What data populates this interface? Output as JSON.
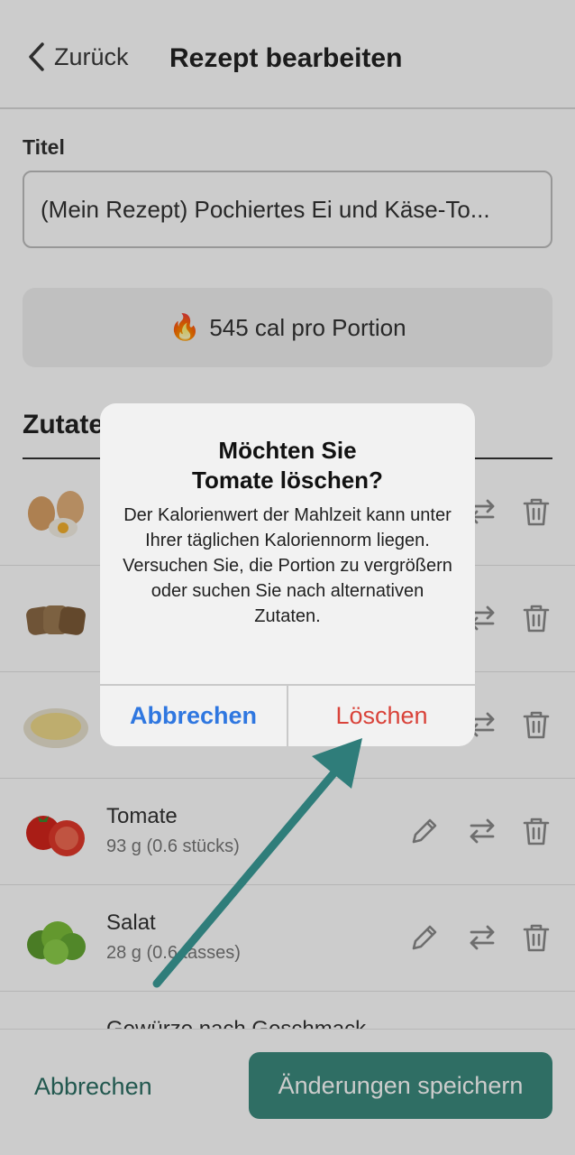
{
  "header": {
    "back_label": "Zurück",
    "title": "Rezept bearbeiten"
  },
  "form": {
    "title_label": "Titel",
    "title_value": "(Mein Rezept) Pochiertes Ei und Käse-To...",
    "calories_text": "545 cal pro Portion"
  },
  "ingredients": {
    "heading": "Zutaten",
    "items": [
      {
        "name": "",
        "amount": ""
      },
      {
        "name": "",
        "amount": ""
      },
      {
        "name": "",
        "amount": ""
      },
      {
        "name": "Tomate",
        "amount": "93 g (0.6 stücks)"
      },
      {
        "name": "Salat",
        "amount": "28 g (0.6 tasses)"
      },
      {
        "name": "Gewürze nach Geschmack",
        "amount": ""
      }
    ]
  },
  "footer": {
    "cancel_label": "Abbrechen",
    "save_label": "Änderungen speichern"
  },
  "dialog": {
    "title_line1": "Möchten Sie",
    "title_line2": "Tomate löschen?",
    "message": "Der Kalorienwert der Mahlzeit kann unter Ihrer täglichen Kaloriennorm liegen. Versuchen Sie, die Portion zu vergrößern oder suchen Sie nach alternativen Zutaten.",
    "cancel_label": "Abbrechen",
    "delete_label": "Löschen"
  },
  "colors": {
    "accent": "#3b8a7d",
    "dialog_cancel": "#2f77e0",
    "dialog_delete": "#d9433a",
    "annotation_arrow": "#2f7d7a"
  }
}
